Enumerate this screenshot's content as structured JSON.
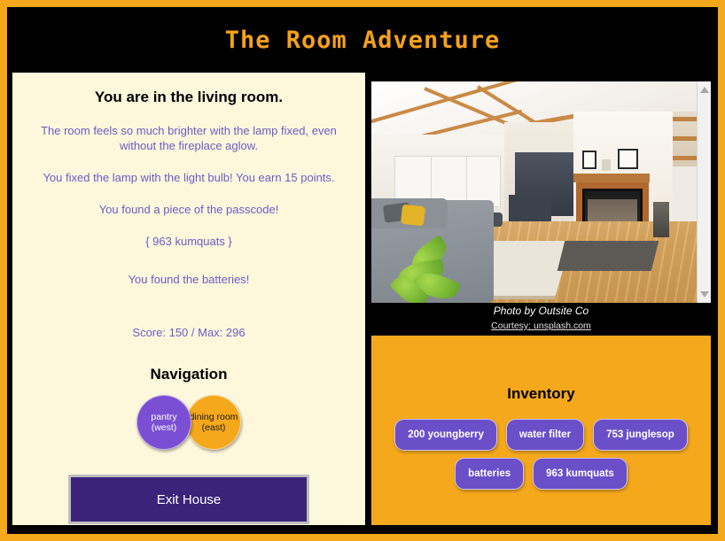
{
  "app": {
    "title": "The Room Adventure",
    "accent_orange": "#f5a81c",
    "panel_cream": "#fdf8dc",
    "purple_text": "#6c5bc4",
    "button_purple": "#3a2379",
    "item_purple": "#6b4fc9",
    "background": "#000000"
  },
  "room": {
    "heading": "You are in the living room.",
    "description": "The room feels so much brighter with the lamp fixed, even without the fireplace aglow.",
    "action_result": "You fixed the lamp with the light bulb! You earn 15 points.",
    "passcode_found": "You found a piece of the passcode!",
    "passcode_value": "{ 963 kumquats }",
    "item_found": "You found the batteries!",
    "score_line": "Score: 150 / Max: 296",
    "score": 150,
    "max_score": 296
  },
  "navigation": {
    "heading": "Navigation",
    "exits": [
      {
        "name": "pantry",
        "direction": "(west)",
        "color": "#7b4fd4",
        "text_color": "#ffffff"
      },
      {
        "name": "dining room",
        "direction": "(east)",
        "color": "#f5a81c",
        "text_color": "#1a1a1a"
      }
    ],
    "exit_button_label": "Exit House"
  },
  "photo": {
    "alt": "living-room-photo",
    "credit": "Photo by Outsite Co",
    "courtesy": "Courtesy: unsplash.com",
    "scrollbar": {
      "up_arrow": "scroll-up-icon",
      "down_arrow": "scroll-down-icon"
    }
  },
  "inventory": {
    "heading": "Inventory",
    "items": [
      "200 youngberry",
      "water filter",
      "753 junglesop",
      "batteries",
      "963 kumquats"
    ]
  }
}
